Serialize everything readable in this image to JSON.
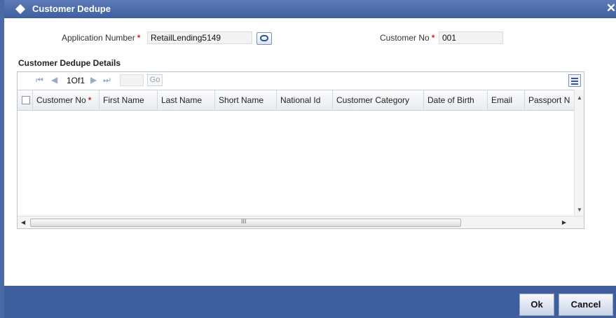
{
  "window": {
    "title": "Customer Dedupe",
    "close_symbol": "✕"
  },
  "form": {
    "application_number": {
      "label": "Application Number",
      "required_mark": "*",
      "value": "RetailLending5149"
    },
    "customer_no": {
      "label": "Customer No",
      "required_mark": "*",
      "value": "001"
    }
  },
  "section": {
    "title": "Customer Dedupe Details"
  },
  "pager": {
    "page_text": "1Of1",
    "go_label": "Go",
    "page_input_value": ""
  },
  "table": {
    "columns": [
      {
        "label": "Customer No",
        "required_mark": "*"
      },
      {
        "label": "First Name"
      },
      {
        "label": "Last Name"
      },
      {
        "label": "Short Name"
      },
      {
        "label": "National Id"
      },
      {
        "label": "Customer Category"
      },
      {
        "label": "Date of Birth"
      },
      {
        "label": "Email"
      },
      {
        "label": "Passport N"
      }
    ],
    "rows": []
  },
  "scroll": {
    "grip": "III"
  },
  "buttons": {
    "ok": "Ok",
    "cancel": "Cancel"
  },
  "colors": {
    "titlebar": "#4a6aa5",
    "footer": "#3e5e9e",
    "required": "#d9251c"
  }
}
